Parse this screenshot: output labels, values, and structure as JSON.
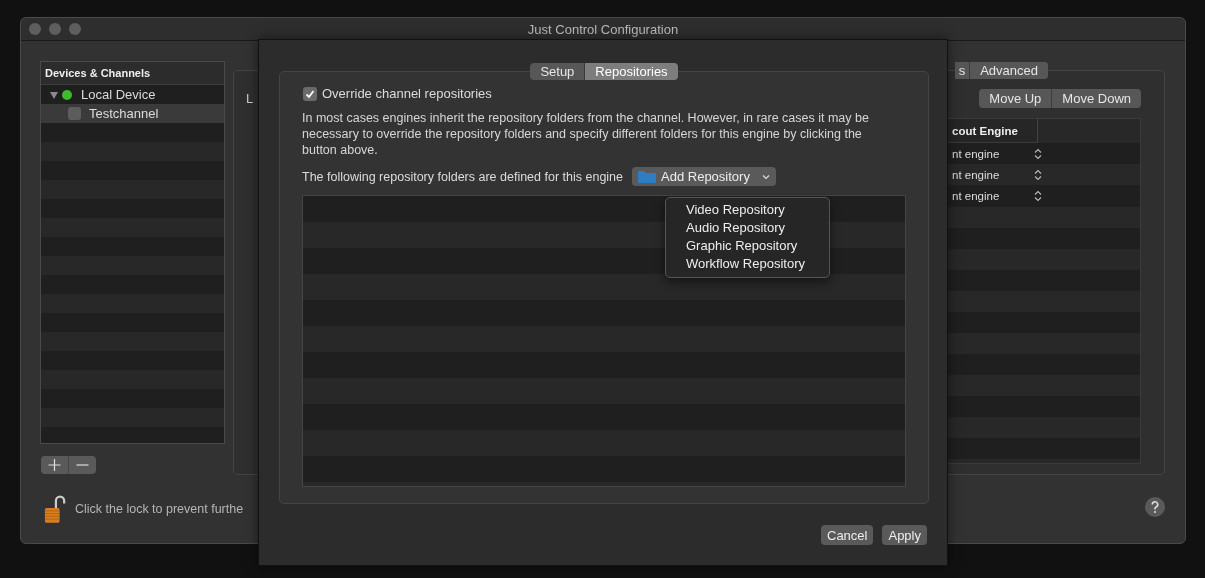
{
  "window": {
    "title": "Just Control Configuration"
  },
  "sidebar": {
    "header": "Devices & Channels",
    "items": [
      {
        "label": "Local Device",
        "expanded": true,
        "selected": false,
        "color": "#3dbb2c",
        "children": [
          {
            "label": "Testchannel",
            "checked": false,
            "selected": true
          }
        ]
      }
    ]
  },
  "lock": {
    "locked": false,
    "text": "Click the lock to prevent furthe"
  },
  "engine_panel": {
    "label_fragment": "L",
    "tabs": [
      {
        "label": "s",
        "selected": false
      },
      {
        "label": "Advanced",
        "selected": false
      }
    ],
    "buttons": [
      "Move Up",
      "Move Down"
    ],
    "table": {
      "column": "cout Engine",
      "rows": [
        "nt engine",
        "nt engine",
        "nt engine"
      ]
    }
  },
  "sheet": {
    "tabs": [
      {
        "label": "Setup",
        "selected": false
      },
      {
        "label": "Repositories",
        "selected": true
      }
    ],
    "override": {
      "label": "Override channel repositories",
      "checked": true
    },
    "description": "In most cases engines inherit the repository folders from the channel. However, in rare cases it may be necessary to override the repository folders and specify different folders for this engine by clicking the button above.",
    "folders_label": "The following repository folders are defined for this engine",
    "add_button": "Add Repository",
    "menu": {
      "items": [
        "Video Repository",
        "Audio Repository",
        "Graphic Repository",
        "Workflow Repository"
      ]
    },
    "buttons": [
      "Cancel",
      "Apply"
    ]
  }
}
